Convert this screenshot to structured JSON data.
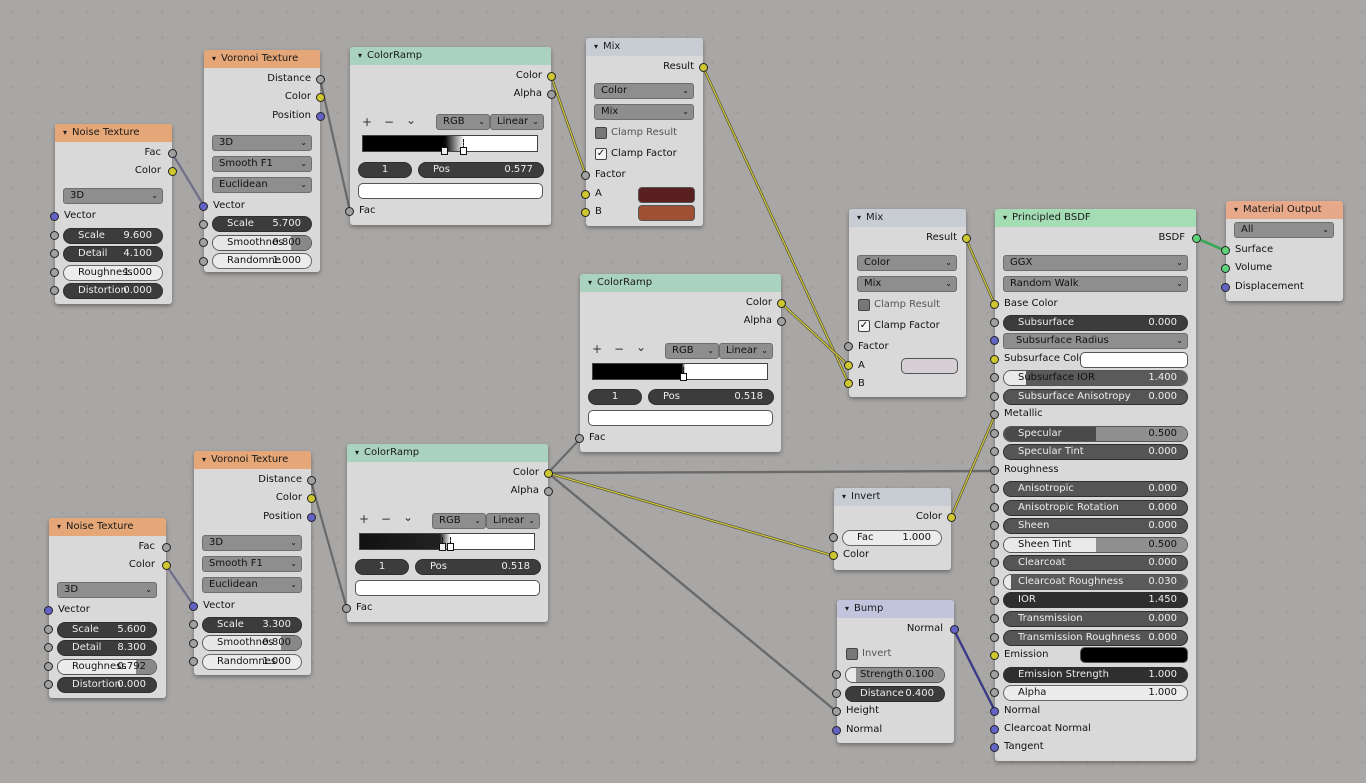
{
  "colors": {
    "background": "#a9a7a5",
    "texture_header": "#e5a777",
    "converter_header": "#a9d2c0",
    "shader_header": "#a4ddb4",
    "output_header": "#e7a98a",
    "wire_color": "#d5cb3a",
    "wire_gray": "#7e7e7e",
    "mix1_a": "#5a2021",
    "mix1_b": "#a05134",
    "mix2_a": "#d6d0d6",
    "subsurface_color": "#ffffff",
    "emission": "#000000"
  },
  "noise1": {
    "title": "Noise Texture",
    "out_fac": "Fac",
    "out_color": "Color",
    "dimension": "3D",
    "in_vector": "Vector",
    "scale_label": "Scale",
    "scale_value": "9.600",
    "detail_label": "Detail",
    "detail_value": "4.100",
    "roughness_label": "Roughness",
    "roughness_value": "1.000",
    "distortion_label": "Distortion",
    "distortion_value": "0.000"
  },
  "voronoi1": {
    "title": "Voronoi Texture",
    "out_distance": "Distance",
    "out_color": "Color",
    "out_position": "Position",
    "dimension": "3D",
    "feature": "Smooth F1",
    "metric": "Euclidean",
    "in_vector": "Vector",
    "scale_label": "Scale",
    "scale_value": "5.700",
    "smooth_label": "Smoothnes",
    "smooth_value": "0.800",
    "smooth_fraction": 0.8,
    "random_label": "Randomne",
    "random_value": "1.000"
  },
  "ramp1": {
    "title": "ColorRamp",
    "out_color": "Color",
    "out_alpha": "Alpha",
    "plus": "+",
    "minus": "−",
    "menu": "⌄",
    "mode": "RGB",
    "interp": "Linear",
    "index": "1",
    "pos_label": "Pos",
    "pos_value": "0.577",
    "in_fac": "Fac"
  },
  "mix1": {
    "title": "Mix",
    "out_result": "Result",
    "type": "Color",
    "blend": "Mix",
    "clamp_result": "Clamp Result",
    "clamp_factor": "Clamp Factor",
    "clamp_result_checked": false,
    "clamp_factor_checked": true,
    "in_factor": "Factor",
    "in_a": "A",
    "in_b": "B"
  },
  "ramp2": {
    "title": "ColorRamp",
    "out_color": "Color",
    "out_alpha": "Alpha",
    "plus": "+",
    "minus": "−",
    "menu": "⌄",
    "mode": "RGB",
    "interp": "Linear",
    "index": "1",
    "pos_label": "Pos",
    "pos_value": "0.518",
    "in_fac": "Fac"
  },
  "mix2": {
    "title": "Mix",
    "out_result": "Result",
    "type": "Color",
    "blend": "Mix",
    "clamp_result": "Clamp Result",
    "clamp_factor": "Clamp Factor",
    "clamp_result_checked": false,
    "clamp_factor_checked": true,
    "in_factor": "Factor",
    "in_a": "A",
    "in_b": "B"
  },
  "bsdf": {
    "title": "Principled BSDF",
    "out_bsdf": "BSDF",
    "distribution": "GGX",
    "subsurface_method": "Random Walk",
    "base_color": "Base Color",
    "subsurface_label": "Subsurface",
    "subsurface_value": "0.000",
    "subsurface_radius": "Subsurface Radius",
    "subsurface_color": "Subsurface Color",
    "ss_ior_label": "Subsurface IOR",
    "ss_ior_value": "1.400",
    "ss_aniso_label": "Subsurface Anisotropy",
    "ss_aniso_value": "0.000",
    "metallic": "Metallic",
    "specular_label": "Specular",
    "specular_value": "0.500",
    "specular_fraction": 0.5,
    "spec_tint_label": "Specular Tint",
    "spec_tint_value": "0.000",
    "roughness": "Roughness",
    "aniso_label": "Anisotropic",
    "aniso_value": "0.000",
    "aniso_rot_label": "Anisotropic Rotation",
    "aniso_rot_value": "0.000",
    "sheen_label": "Sheen",
    "sheen_value": "0.000",
    "sheen_tint_label": "Sheen Tint",
    "sheen_tint_value": "0.500",
    "sheen_tint_fraction": 0.5,
    "clearcoat_label": "Clearcoat",
    "clearcoat_value": "0.000",
    "cc_rough_label": "Clearcoat Roughness",
    "cc_rough_value": "0.030",
    "ior_label": "IOR",
    "ior_value": "1.450",
    "transmission_label": "Transmission",
    "transmission_value": "0.000",
    "trans_rough_label": "Transmission Roughness",
    "trans_rough_value": "0.000",
    "emission": "Emission",
    "em_strength_label": "Emission Strength",
    "em_strength_value": "1.000",
    "alpha_label": "Alpha",
    "alpha_value": "1.000",
    "normal": "Normal",
    "cc_normal": "Clearcoat Normal",
    "tangent": "Tangent"
  },
  "output": {
    "title": "Material Output",
    "target": "All",
    "surface": "Surface",
    "volume": "Volume",
    "displacement": "Displacement"
  },
  "voronoi2": {
    "title": "Voronoi Texture",
    "out_distance": "Distance",
    "out_color": "Color",
    "out_position": "Position",
    "dimension": "3D",
    "feature": "Smooth F1",
    "metric": "Euclidean",
    "in_vector": "Vector",
    "scale_label": "Scale",
    "scale_value": "3.300",
    "smooth_label": "Smoothnes",
    "smooth_value": "0.800",
    "smooth_fraction": 0.8,
    "random_label": "Randomnes",
    "random_value": "1.000"
  },
  "noise2": {
    "title": "Noise Texture",
    "out_fac": "Fac",
    "out_color": "Color",
    "dimension": "3D",
    "in_vector": "Vector",
    "scale_label": "Scale",
    "scale_value": "5.600",
    "detail_label": "Detail",
    "detail_value": "8.300",
    "roughness_label": "Roughness",
    "roughness_value": "0.792",
    "roughness_fraction": 0.792,
    "distortion_label": "Distortion",
    "distortion_value": "0.000"
  },
  "ramp3": {
    "title": "ColorRamp",
    "out_color": "Color",
    "out_alpha": "Alpha",
    "plus": "+",
    "minus": "−",
    "menu": "⌄",
    "mode": "RGB",
    "interp": "Linear",
    "index": "1",
    "pos_label": "Pos",
    "pos_value": "0.518",
    "in_fac": "Fac"
  },
  "invert": {
    "title": "Invert",
    "out_color": "Color",
    "fac_label": "Fac",
    "fac_value": "1.000",
    "in_color": "Color"
  },
  "bump": {
    "title": "Bump",
    "out_normal": "Normal",
    "invert_label": "Invert",
    "invert_checked": false,
    "strength_label": "Strength",
    "strength_value": "0.100",
    "distance_label": "Distance",
    "distance_value": "0.400",
    "in_height": "Height",
    "in_normal": "Normal"
  }
}
